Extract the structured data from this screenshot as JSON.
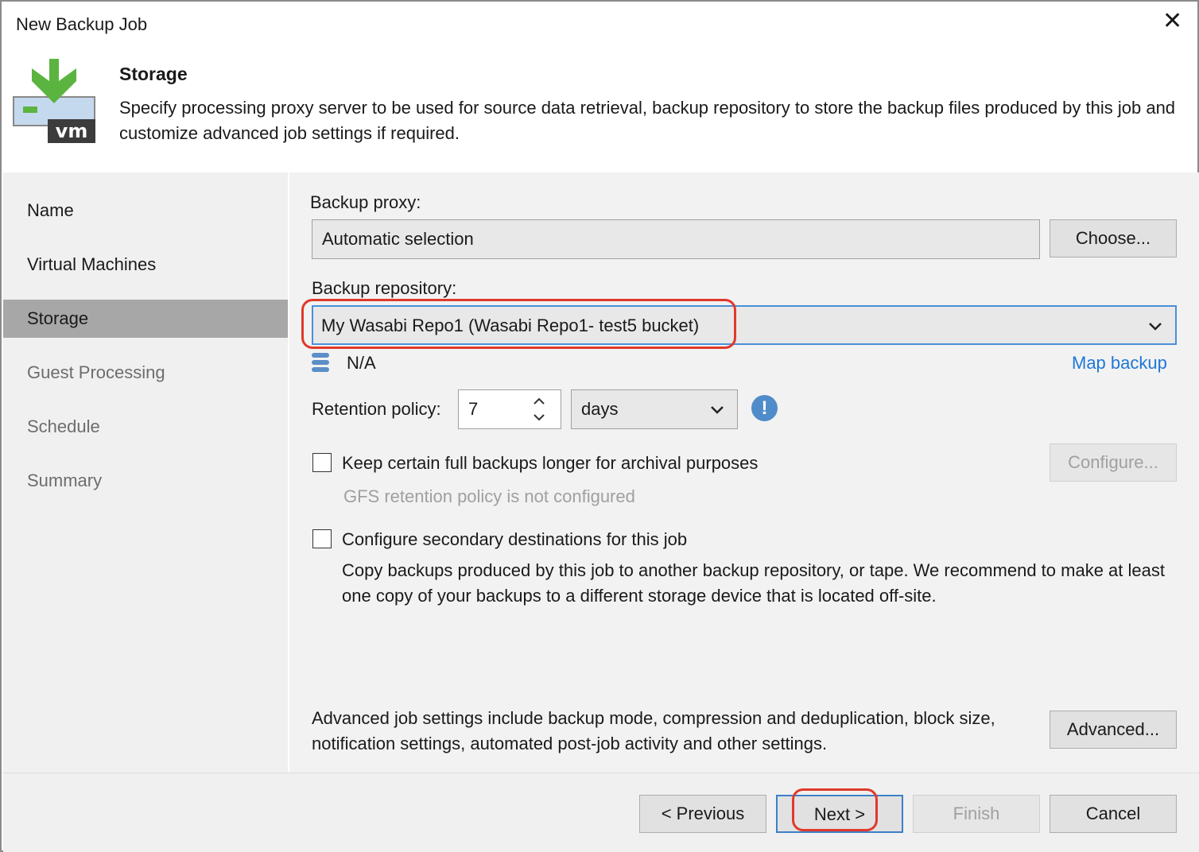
{
  "window": {
    "title": "New Backup Job",
    "close_icon": "close-icon"
  },
  "header": {
    "title": "Storage",
    "description": "Specify processing proxy server to be used for source data retrieval, backup repository to store the backup files produced by this job and customize advanced job settings if required.",
    "logo": "vm-backup-logo"
  },
  "nav": {
    "items": [
      {
        "label": "Name"
      },
      {
        "label": "Virtual Machines"
      },
      {
        "label": "Storage",
        "selected": true
      },
      {
        "label": "Guest Processing"
      },
      {
        "label": "Schedule"
      },
      {
        "label": "Summary"
      }
    ]
  },
  "form": {
    "proxy_label": "Backup proxy:",
    "proxy_value": "Automatic selection",
    "choose_label": "Choose...",
    "repo_label": "Backup repository:",
    "repo_value": "My Wasabi Repo1 (Wasabi Repo1- test5 bucket)",
    "repo_free": "N/A",
    "map_backup": "Map backup",
    "retention_label": "Retention policy:",
    "retention_value": "7",
    "retention_unit": "days",
    "gfs_label": "Keep certain full backups longer for archival purposes",
    "gfs_checked": false,
    "gfs_status": "GFS retention policy is not configured",
    "configure_label": "Configure...",
    "secondary_label": "Configure secondary destinations for this job",
    "secondary_checked": false,
    "secondary_desc": "Copy backups produced by this job to another backup repository, or tape. We recommend to make at least one copy of your backups to a different storage device that is located off-site.",
    "advanced_desc": "Advanced job settings include backup mode, compression and deduplication, block size, notification settings, automated post-job activity and other settings.",
    "advanced_label": "Advanced..."
  },
  "footer": {
    "previous": "< Previous",
    "next": "Next >",
    "finish": "Finish",
    "cancel": "Cancel"
  },
  "colors": {
    "highlight": "#e0392b",
    "link": "#1e78d6",
    "selected_nav": "#a7a7a7"
  }
}
